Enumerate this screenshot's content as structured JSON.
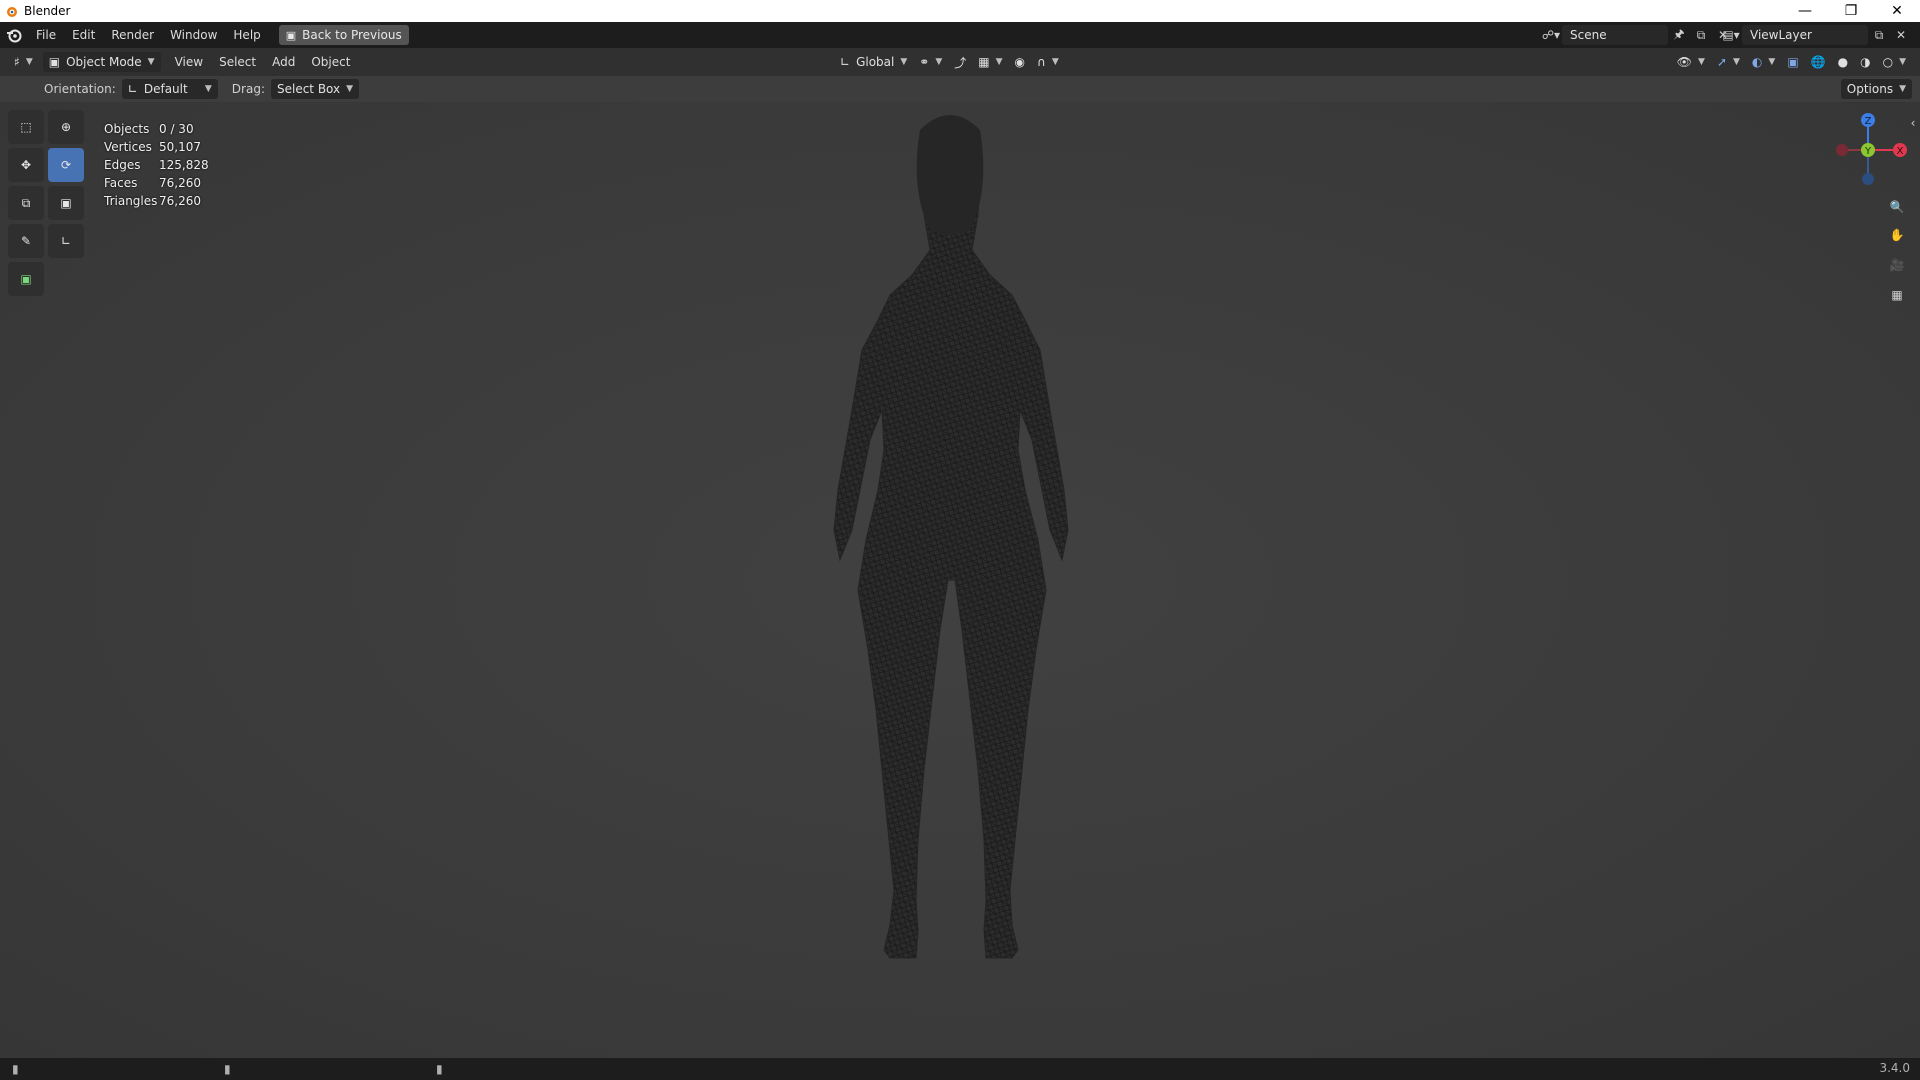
{
  "window": {
    "title": "Blender",
    "controls": [
      "minimize-icon",
      "maximize-icon",
      "close-icon"
    ]
  },
  "topbar": {
    "menus": [
      "File",
      "Edit",
      "Render",
      "Window",
      "Help"
    ],
    "back_button": "Back to Previous",
    "scene": "Scene",
    "view_layer": "ViewLayer"
  },
  "header": {
    "mode": "Object Mode",
    "menus": [
      "View",
      "Select",
      "Add",
      "Object"
    ],
    "transform_orientation": "Global"
  },
  "tool_settings": {
    "orientation_label": "Orientation:",
    "orientation_value": "Default",
    "drag_label": "Drag:",
    "drag_value": "Select Box",
    "options": "Options"
  },
  "stats": [
    {
      "label": "Objects",
      "value": "0 / 30"
    },
    {
      "label": "Vertices",
      "value": "50,107"
    },
    {
      "label": "Edges",
      "value": "125,828"
    },
    {
      "label": "Faces",
      "value": "76,260"
    },
    {
      "label": "Triangles",
      "value": "76,260"
    }
  ],
  "gizmo": {
    "z": "Z",
    "y": "Y",
    "x": "X"
  },
  "statusbar": {
    "version": "3.4.0"
  },
  "colors": {
    "accent": "#4772b3",
    "x_axis": "#e0384e",
    "y_axis": "#8bc730",
    "z_axis": "#3a7ee6"
  }
}
